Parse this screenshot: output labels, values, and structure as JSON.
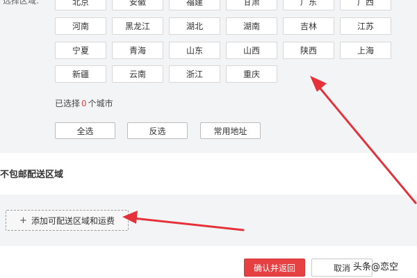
{
  "region_section": {
    "label_partial": "选择区域:",
    "rows": [
      [
        "北京",
        "安徽",
        "福建",
        "甘肃",
        "广东",
        "广西"
      ],
      [
        "河南",
        "黑龙江",
        "湖北",
        "湖南",
        "吉林",
        "江苏"
      ],
      [
        "宁夏",
        "青海",
        "山东",
        "山西",
        "陕西",
        "上海"
      ],
      [
        "新疆",
        "云南",
        "浙江",
        "重庆"
      ]
    ],
    "selected_prefix": "已选择",
    "selected_count": "0",
    "selected_suffix": "个城市",
    "select_all_label": "全选",
    "invert_label": "反选",
    "common_address_label": "常用地址"
  },
  "no_ship_section": {
    "title": "不包邮配送区域"
  },
  "add_area": {
    "plus_icon": "+",
    "label": "添加可配送区域和运费"
  },
  "footer": {
    "confirm_label": "确认并返回",
    "cancel_label": "取消"
  },
  "watermark": "头条@恋空",
  "colors": {
    "accent_red": "#e74043",
    "panel_bg": "#f3f4f6",
    "count_red": "#e04a4a",
    "annotation_arrow": "#e5323a"
  }
}
